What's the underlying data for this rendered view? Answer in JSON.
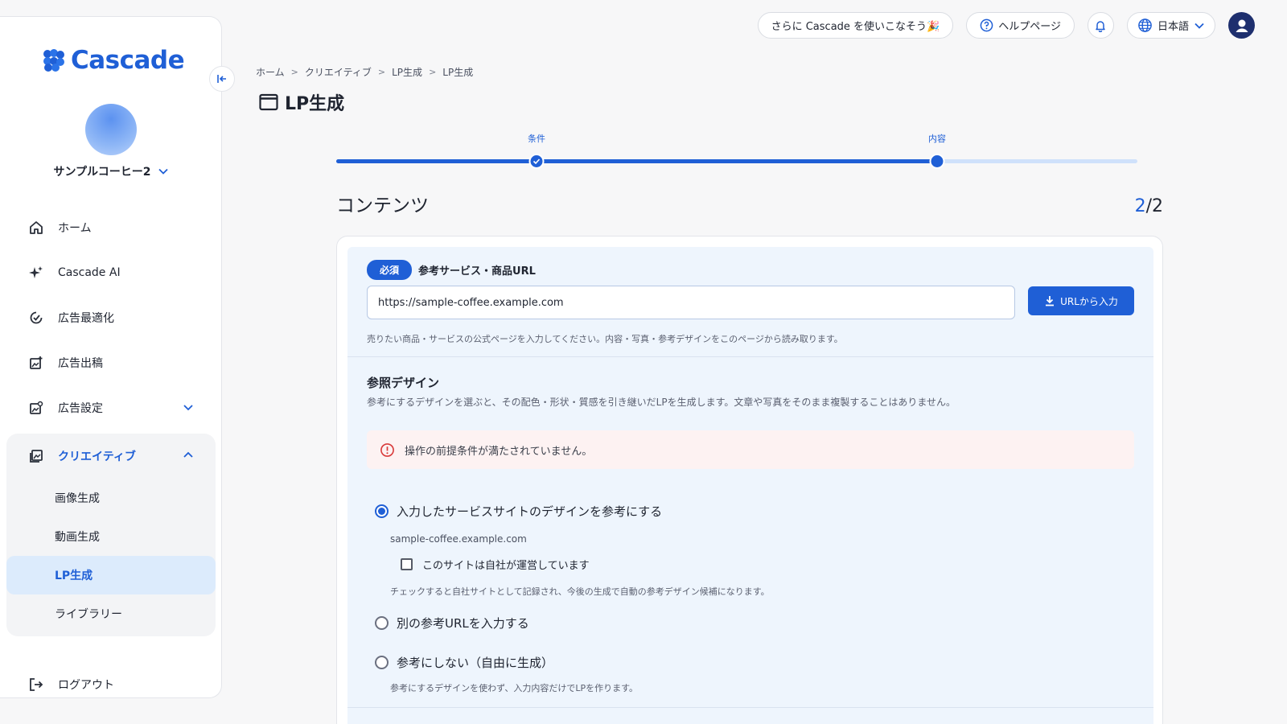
{
  "brand": {
    "name": "Cascade",
    "color": "#1f5fd6"
  },
  "account": {
    "name": "サンプルコーヒー2"
  },
  "sidebar": {
    "items": [
      {
        "label": "ホーム",
        "icon": "home-icon"
      },
      {
        "label": "Cascade AI",
        "icon": "sparkle-icon"
      },
      {
        "label": "広告最適化",
        "icon": "optimize-icon"
      },
      {
        "label": "広告出稿",
        "icon": "ad-publish-icon"
      },
      {
        "label": "広告設定",
        "icon": "ad-settings-icon"
      }
    ],
    "creative": {
      "label": "クリエイティブ",
      "subitems": [
        "画像生成",
        "動画生成",
        "LP生成",
        "ライブラリー"
      ]
    },
    "logout": "ログアウト"
  },
  "topbar": {
    "promo": "さらに Cascade を使いこなそう🎉",
    "help": "ヘルプページ",
    "language": "日本語"
  },
  "breadcrumb": [
    "ホーム",
    "クリエイティブ",
    "LP生成",
    "LP生成"
  ],
  "page": {
    "title": "LP生成"
  },
  "stepper": {
    "steps": [
      {
        "label": "条件",
        "position": 0.25
      },
      {
        "label": "内容",
        "position": 0.75
      }
    ],
    "progress": 0.75
  },
  "section": {
    "title": "コンテンツ",
    "current": "2",
    "total": "/2"
  },
  "form": {
    "required_badge": "必須",
    "url_label": "参考サービス・商品URL",
    "url_value": "https://sample-coffee.example.com",
    "url_button": "URLから入力",
    "url_help": "売りたい商品・サービスの公式ページを入力してください。内容・写真・参考デザインをこのページから読み取ります。",
    "ref_title": "参照デザイン",
    "ref_desc": "参考にするデザインを選ぶと、その配色・形状・質感を引き継いだLPを生成します。文章や写真をそのまま複製することはありません。",
    "alert": "操作の前提条件が満たされていません。",
    "option1": "入力したサービスサイトのデザインを参考にする",
    "domain": "sample-coffee.example.com",
    "own_site": "このサイトは自社が運営しています",
    "own_site_help": "チェックすると自社サイトとして記録され、今後の生成で自動の参考デザイン候補になります。",
    "option2": "別の参考URLを入力する",
    "option3": "参考にしない（自由に生成）",
    "option3_help": "参考にするデザインを使わず、入力内容だけでLPを作ります。"
  }
}
